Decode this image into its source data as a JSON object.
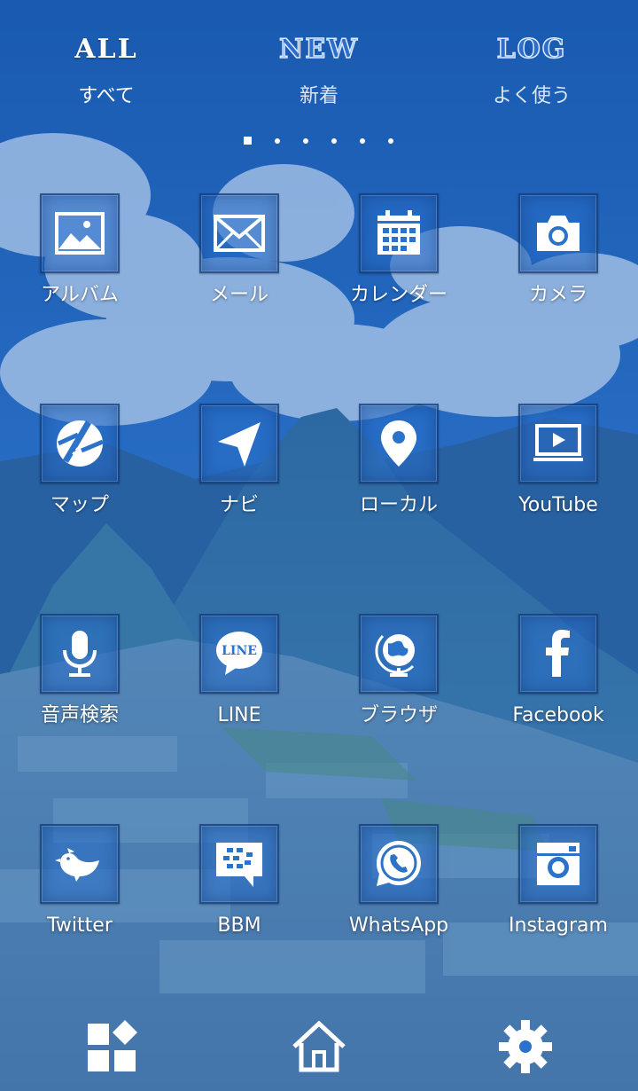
{
  "tabs": [
    {
      "en": "ALL",
      "jp": "すべて",
      "active": true
    },
    {
      "en": "NEW",
      "jp": "新着",
      "active": false
    },
    {
      "en": "LOG",
      "jp": "よく使う",
      "active": false
    }
  ],
  "pager": {
    "count": 6,
    "current": 1
  },
  "apps": [
    {
      "label": "アルバム",
      "icon": "album-icon"
    },
    {
      "label": "メール",
      "icon": "mail-icon"
    },
    {
      "label": "カレンダー",
      "icon": "calendar-icon"
    },
    {
      "label": "カメラ",
      "icon": "camera-icon"
    },
    {
      "label": "マップ",
      "icon": "map-icon"
    },
    {
      "label": "ナビ",
      "icon": "navigation-icon"
    },
    {
      "label": "ローカル",
      "icon": "location-pin-icon"
    },
    {
      "label": "YouTube",
      "icon": "youtube-icon"
    },
    {
      "label": "音声検索",
      "icon": "microphone-icon"
    },
    {
      "label": "LINE",
      "icon": "line-icon"
    },
    {
      "label": "ブラウザ",
      "icon": "globe-icon"
    },
    {
      "label": "Facebook",
      "icon": "facebook-icon"
    },
    {
      "label": "Twitter",
      "icon": "twitter-bird-icon"
    },
    {
      "label": "BBM",
      "icon": "bbm-icon"
    },
    {
      "label": "WhatsApp",
      "icon": "whatsapp-icon"
    },
    {
      "label": "Instagram",
      "icon": "instagram-icon"
    }
  ],
  "line_logo_text": "LINE",
  "dock": [
    {
      "icon": "widgets-icon"
    },
    {
      "icon": "home-icon"
    },
    {
      "icon": "settings-gear-icon"
    }
  ],
  "colors": {
    "sky": "#1f63b4",
    "tint": "#2b72c8",
    "white": "#ffffff"
  }
}
